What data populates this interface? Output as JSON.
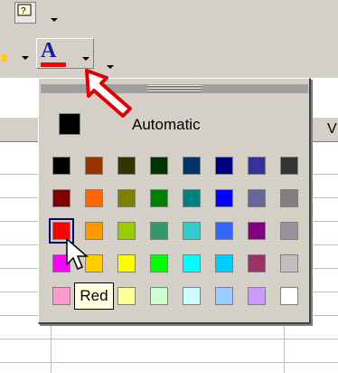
{
  "palette": {
    "automatic_label": "Automatic",
    "colors": [
      "#000000",
      "#993300",
      "#333300",
      "#003300",
      "#003366",
      "#000080",
      "#333399",
      "#333333",
      "#800000",
      "#ff6600",
      "#808000",
      "#008000",
      "#008080",
      "#0000ff",
      "#666699",
      "#808080",
      "#ff0000",
      "#ff9900",
      "#99cc00",
      "#339966",
      "#33cccc",
      "#3366ff",
      "#800080",
      "#969696",
      "#ff00ff",
      "#ffcc00",
      "#ffff00",
      "#00ff00",
      "#00ffff",
      "#00ccff",
      "#993366",
      "#c0c0c0",
      "#ff99cc",
      "#ffcc99",
      "#ffff99",
      "#ccffcc",
      "#ccffff",
      "#99ccff",
      "#cc99ff",
      "#ffffff"
    ],
    "selected_index": 16
  },
  "tooltip": {
    "text": "Red"
  },
  "toolbar": {
    "font_color_letter": "A",
    "help_icon": "help-icon"
  },
  "sheet": {
    "visible_column": "V"
  },
  "colors": {
    "accent": "#ff0000",
    "face": "#d4d0c8",
    "tooltip_bg": "#ffffe1"
  }
}
